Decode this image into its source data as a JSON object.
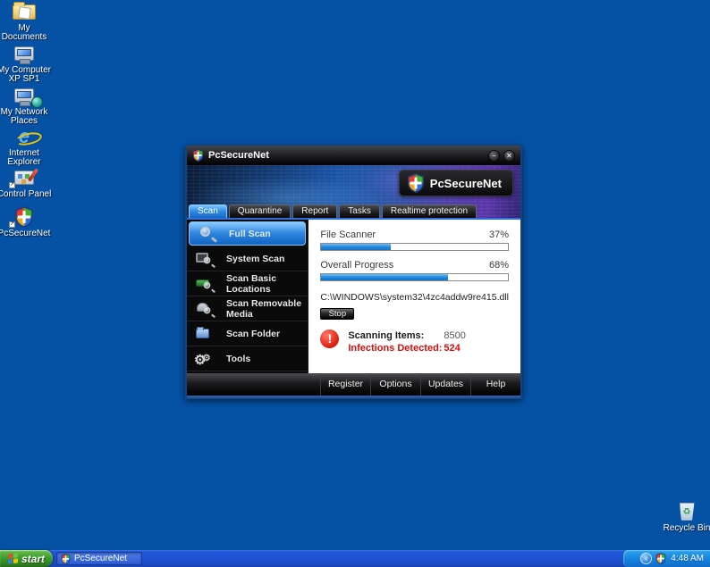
{
  "desktop": {
    "icons": [
      {
        "label": "My Documents"
      },
      {
        "label": "My Computer XP SP1"
      },
      {
        "label": "My Network Places"
      },
      {
        "label": "Internet Explorer"
      },
      {
        "label": "Control Panel"
      },
      {
        "label": "PcSecureNet"
      }
    ],
    "recycle_bin_label": "Recycle Bin"
  },
  "window": {
    "title": "PcSecureNet",
    "logo_text": "PcSecureNet",
    "minimize_glyph": "−",
    "close_glyph": "✕",
    "tabs": [
      {
        "label": "Scan"
      },
      {
        "label": "Quarantine"
      },
      {
        "label": "Report"
      },
      {
        "label": "Tasks"
      },
      {
        "label": "Realtime protection"
      }
    ],
    "sidebar": [
      {
        "label": "Full Scan"
      },
      {
        "label": "System Scan"
      },
      {
        "label": "Scan Basic Locations"
      },
      {
        "label": "Scan Removable Media"
      },
      {
        "label": "Scan Folder"
      },
      {
        "label": "Tools"
      }
    ],
    "scan": {
      "file_scanner_label": "File Scanner",
      "file_scanner_percent": "37%",
      "file_scanner_value": 37,
      "overall_label": "Overall Progress",
      "overall_percent": "68%",
      "overall_value": 68,
      "current_file": "C:\\WINDOWS\\system32\\4zc4addw9re415.dll",
      "stop_label": "Stop",
      "warning_glyph": "!",
      "scanning_items_label": "Scanning Items:",
      "scanning_items_value": "8500",
      "infections_label": "Infections Detected:",
      "infections_value": "524"
    },
    "footer_buttons": [
      {
        "label": "Register"
      },
      {
        "label": "Options"
      },
      {
        "label": "Updates"
      },
      {
        "label": "Help"
      }
    ]
  },
  "taskbar": {
    "start_label": "start",
    "task_label": "PcSecureNet",
    "tray_chevron_glyph": "‹",
    "clock": "4:48 AM"
  },
  "colors": {
    "desktop_blue": "#0552A5",
    "taskbar_blue": "#245EDC",
    "start_green": "#3C9E2D",
    "accent_blue": "#2E87E0",
    "alert_red": "#D90D0D",
    "progress_blue": "#1E86DC"
  }
}
